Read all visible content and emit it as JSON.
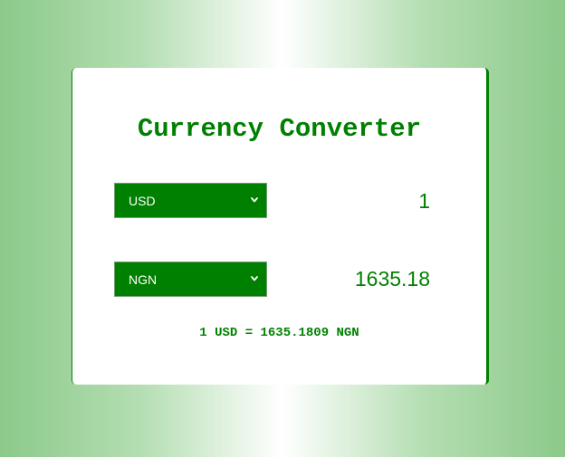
{
  "converter": {
    "title": "Currency Converter",
    "from": {
      "currency": "USD",
      "amount": "1"
    },
    "to": {
      "currency": "NGN",
      "amount": "1635.18"
    },
    "rate_text": "1 USD = 1635.1809 NGN"
  },
  "colors": {
    "accent": "#008000",
    "card_background": "#ffffff",
    "page_gradient_edge": "#8cc98a",
    "page_gradient_center": "#ffffff"
  },
  "icons": {
    "dropdown": "chevron-down-icon"
  }
}
